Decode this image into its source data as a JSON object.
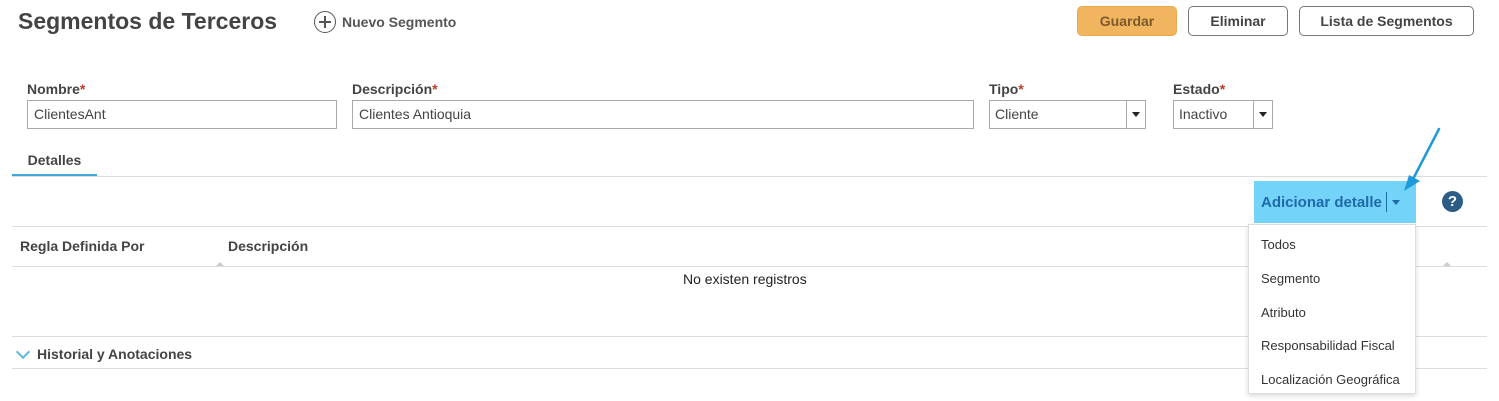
{
  "header": {
    "title": "Segmentos de Terceros",
    "new_segment_label": "Nuevo Segmento",
    "buttons": {
      "save": "Guardar",
      "delete": "Eliminar",
      "list": "Lista de Segmentos"
    }
  },
  "form": {
    "required_mark": "*",
    "nombre": {
      "label": "Nombre",
      "value": "ClientesAnt"
    },
    "descripcion": {
      "label": "Descripción",
      "value": "Clientes Antioquia"
    },
    "tipo": {
      "label": "Tipo",
      "value": "Cliente"
    },
    "estado": {
      "label": "Estado",
      "value": "Inactivo"
    }
  },
  "tabs": [
    {
      "label": "Detalles",
      "active": true
    }
  ],
  "details": {
    "add_button_label": "Adicionar detalle",
    "help_label": "?",
    "columns": [
      "Regla Definida Por",
      "Descripción"
    ],
    "empty_text": "No existen registros",
    "menu_items": [
      "Todos",
      "Segmento",
      "Atributo",
      "Responsabilidad Fiscal",
      "Localización Geográfica"
    ]
  },
  "history": {
    "label": "Historial y Anotaciones"
  },
  "colors": {
    "accent": "#3fa9d8",
    "save": "#f1b55f",
    "add_button": "#74d3f9",
    "required": "#c0392b",
    "annotation_arrow": "#1f9ad8"
  },
  "icons": {
    "new_segment": "plus-circle-icon",
    "help": "help-icon",
    "dropdown": "caret-down-icon",
    "collapse": "chevron-down-icon"
  }
}
